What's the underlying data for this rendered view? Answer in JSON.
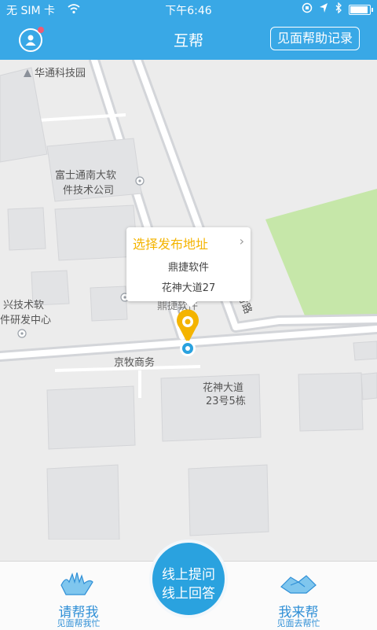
{
  "status": {
    "carrier": "无 SIM 卡",
    "time": "下午6:46"
  },
  "header": {
    "title": "互帮",
    "record_button": "见面帮助记录"
  },
  "map": {
    "labels": {
      "park": "华通科技园",
      "building1_line1": "富士通南大软",
      "building1_line2": "件技术公司",
      "building2_line1": "兴技术软",
      "building2_line2": "件研发中心",
      "dingjie": "鼎捷软件",
      "jingmu": "京牧商务",
      "avenue_line1": "花神大道",
      "avenue_line2": "23号5栋",
      "road": "文竹路"
    },
    "popup": {
      "title": "选择发布地址",
      "name": "鼎捷软件",
      "address": "花神大道27"
    }
  },
  "bottom": {
    "left": {
      "main": "请帮我",
      "sub": "见面帮我忙"
    },
    "center": {
      "line1": "线上提问",
      "line2": "线上回答"
    },
    "right": {
      "main": "我来帮",
      "sub": "见面去帮忙"
    }
  },
  "colors": {
    "brand": "#39a8e6",
    "accent": "#f4b400",
    "map_bg": "#ececec",
    "park_green": "#c6e7a9"
  }
}
